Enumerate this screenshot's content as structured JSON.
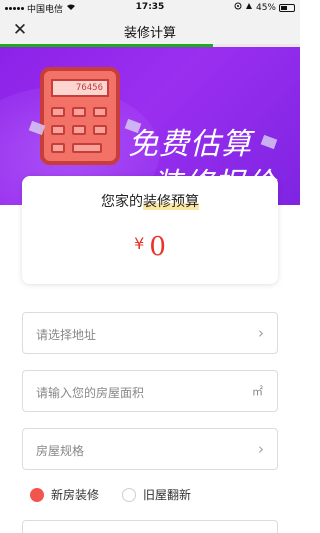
{
  "status_bar": {
    "carrier": "中国电信",
    "time": "17:35",
    "battery_pct": "45%",
    "icons": [
      "signal-icon",
      "wifi-icon",
      "location-icon",
      "alarm-icon",
      "battery-icon"
    ]
  },
  "nav": {
    "title": "装修计算",
    "close_icon": "close-icon",
    "progress": 0.71
  },
  "banner": {
    "line1": "免费估算",
    "line2": "装修报价",
    "calculator_display": "76456"
  },
  "budget": {
    "title_prefix": "您家的",
    "title_highlight": "装修预算",
    "currency": "¥",
    "amount": "0"
  },
  "form": {
    "address": {
      "placeholder": "请选择地址",
      "icon": "chevron-right-icon"
    },
    "area": {
      "placeholder": "请输入您的房屋面积",
      "unit": "㎡"
    },
    "layout": {
      "placeholder": "房屋规格",
      "icon": "chevron-right-icon"
    },
    "house_type": {
      "options": [
        "新房装修",
        "旧屋翻新"
      ],
      "selected": "新房装修"
    }
  },
  "colors": {
    "accent_red": "#e8332a",
    "banner_purple": "#8c22e8",
    "progress_green": "#1aad19"
  }
}
